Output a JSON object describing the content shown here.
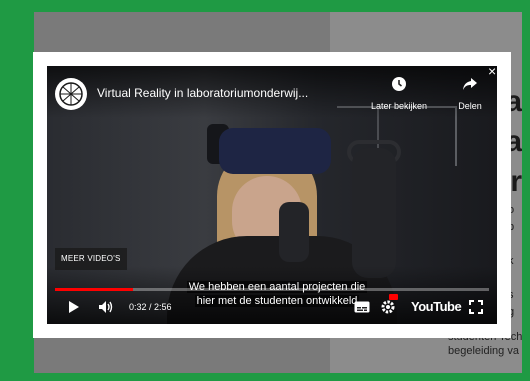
{
  "background_page": {
    "right_letters": [
      "a",
      "a",
      "r"
    ],
    "right_small_chars": [
      "o",
      "p",
      "t",
      "k",
      "i",
      "s",
      "g"
    ],
    "bottom_text": [
      "studenten Tech",
      "begeleiding va"
    ]
  },
  "video": {
    "title": "Virtual Reality in laboratoriumonderwij...",
    "watch_later_label": "Later bekijken",
    "share_label": "Delen",
    "more_videos_label": "MEER VIDEO'S",
    "caption_line1": "We hebben een aantal projecten die",
    "caption_line2": "hier met de studenten ontwikkeld",
    "time_display": "0:32 / 2:56",
    "progress": 0.18,
    "youtube_label": "YouTube",
    "close_glyph": "×"
  },
  "colors": {
    "frame_green": "#1f9a44",
    "progress_red": "#ff0000"
  },
  "icons": {
    "channel": "channel-logo-icon",
    "watch_later": "clock-icon",
    "share": "share-arrow-icon",
    "play": "play-icon",
    "volume": "volume-icon",
    "subtitles": "subtitles-icon",
    "settings": "settings-gear-icon",
    "fullscreen": "fullscreen-icon"
  }
}
